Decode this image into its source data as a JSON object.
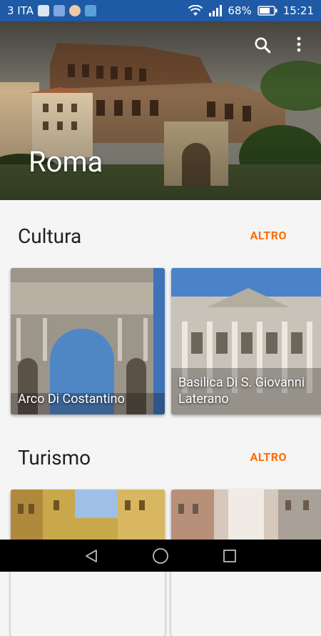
{
  "status_bar": {
    "carrier": "3 ITA",
    "battery": "68%",
    "time": "15:21",
    "icons": [
      "photo-icon",
      "bluetooth-app-icon",
      "avatar-icon",
      "gallery-icon",
      "wifi-icon",
      "signal-icon",
      "battery-icon"
    ]
  },
  "hero": {
    "title": "Roma",
    "actions": [
      "search-icon",
      "more-vert-icon"
    ]
  },
  "sections": [
    {
      "title": "Cultura",
      "more_label": "ALTRO",
      "cards": [
        {
          "label": "Arco Di Costantino"
        },
        {
          "label": "Basilica Di S. Giovanni Laterano"
        }
      ]
    },
    {
      "title": "Turismo",
      "more_label": "ALTRO",
      "cards": [
        {
          "label": ""
        },
        {
          "label": ""
        }
      ]
    }
  ],
  "nav_bar": {
    "buttons": [
      "back-icon",
      "home-icon",
      "recents-icon"
    ]
  },
  "colors": {
    "status_bar": "#1e5aa6",
    "accent": "#ff6d00",
    "background": "#f5f5f5"
  }
}
